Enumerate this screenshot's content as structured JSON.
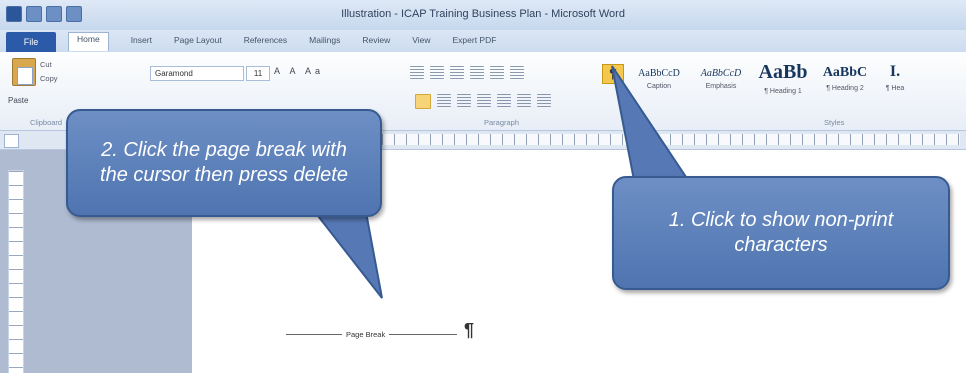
{
  "window": {
    "title": "Illustration - ICAP Training Business Plan - Microsoft Word"
  },
  "tabs": [
    "File",
    "Home",
    "Insert",
    "Page Layout",
    "References",
    "Mailings",
    "Review",
    "View",
    "Expert PDF"
  ],
  "ribbon": {
    "clipboard": {
      "paste_label": "Paste",
      "cut_label": "Cut",
      "copy_label": "Copy",
      "group_label": "Clipboard"
    },
    "font": {
      "font_name": "Garamond",
      "font_size": "11",
      "tools": "A A Aa"
    },
    "paragraph": {
      "group_label": "Paragraph",
      "show_hide_symbol": "¶"
    },
    "styles": {
      "group_label": "Styles",
      "items": [
        {
          "sample": "AaBbCcD",
          "name": "Caption"
        },
        {
          "sample": "AaBbCcD",
          "name": "Emphasis"
        },
        {
          "sample": "AaBb",
          "name": "¶ Heading 1"
        },
        {
          "sample": "AaBbC",
          "name": "¶ Heading 2"
        },
        {
          "sample": "I.",
          "name": "¶ Hea"
        }
      ]
    }
  },
  "document": {
    "page_break_label": "Page Break",
    "cursor_symbol": "¶"
  },
  "callouts": {
    "step2": "2. Click the page break with the cursor then press delete",
    "step1": "1. Click to show non-print characters"
  },
  "colors": {
    "callout_fill": "#5a7ebb",
    "callout_border": "#375a91",
    "highlight": "#f5c84c"
  }
}
